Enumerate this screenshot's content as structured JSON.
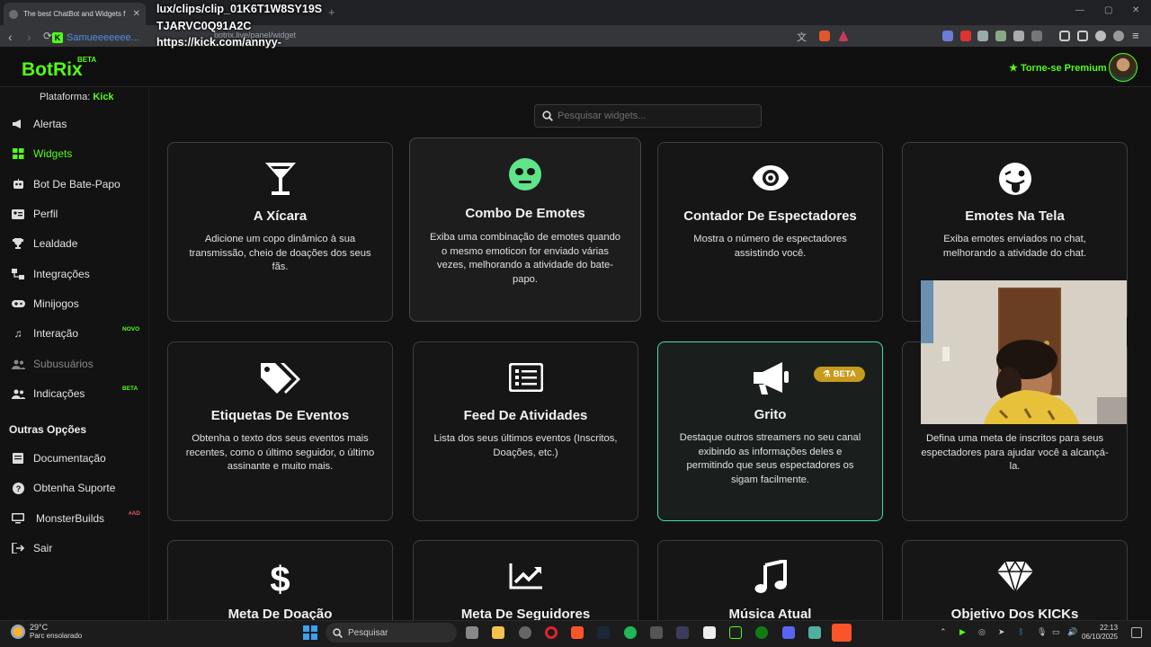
{
  "browser": {
    "tab_title": "The best ChatBot and Widgets f",
    "url": "botrix.live/panel/widget",
    "ghost_channel": "Samueeeeeee..."
  },
  "overlay": {
    "text": "lux/clips/clip_01K6T1W8SY19S\nTJARVC0Q91A2C\nhttps://kick.com/annyy-\nlux/clips/clip_01K6T1W8SY19S\nTJARVC0Q91A2C"
  },
  "header": {
    "logo": "BotRix",
    "logo_badge": "BETA",
    "premium_label": "Torne-se Premium"
  },
  "sidebar": {
    "platform_label": "Plataforma:",
    "platform_value": "Kick",
    "items": [
      {
        "label": "Alertas",
        "icon": "megaphone-icon"
      },
      {
        "label": "Widgets",
        "icon": "grid-icon"
      },
      {
        "label": "Bot De Bate-Papo",
        "icon": "robot-icon"
      },
      {
        "label": "Perfil",
        "icon": "id-card-icon"
      },
      {
        "label": "Lealdade",
        "icon": "trophy-icon"
      },
      {
        "label": "Integrações",
        "icon": "integration-icon"
      },
      {
        "label": "Minijogos",
        "icon": "gamepad-icon"
      },
      {
        "label": "Interação",
        "icon": "music-icon",
        "badge": "NOVO"
      },
      {
        "label": "Subusuários",
        "icon": "users-icon"
      },
      {
        "label": "Indicações",
        "icon": "user-group-icon",
        "badge": "BETA"
      }
    ],
    "other_heading": "Outras Opções",
    "other_items": [
      {
        "label": "Documentação",
        "icon": "book-icon"
      },
      {
        "label": "Obtenha Suporte",
        "icon": "help-icon"
      },
      {
        "label": "MonsterBuilds",
        "icon": "monitor-icon",
        "badge": "#AD"
      },
      {
        "label": "Sair",
        "icon": "logout-icon"
      }
    ]
  },
  "search": {
    "placeholder": "Pesquisar widgets..."
  },
  "widgets": [
    {
      "title": "A Xícara",
      "desc": "Adicione um copo dinâmico à sua transmissão, cheio de doações dos seus fãs.",
      "icon": "cocktail-icon"
    },
    {
      "title": "Combo De Emotes",
      "desc": "Exiba uma combinação de emotes quando o mesmo emoticon for enviado várias vezes, melhorando a atividade do bate-papo.",
      "icon": "emote-face-icon"
    },
    {
      "title": "Contador De Espectadores",
      "desc": "Mostra o número de espectadores assistindo você.",
      "icon": "eye-icon"
    },
    {
      "title": "Emotes Na Tela",
      "desc": "Exiba emotes enviados no chat, melhorando a atividade do chat.",
      "icon": "tongue-face-icon"
    },
    {
      "title": "Etiquetas De Eventos",
      "desc": "Obtenha o texto dos seus eventos mais recentes, como o último seguidor, o último assinante e muito mais.",
      "icon": "tags-icon"
    },
    {
      "title": "Feed De Atividades",
      "desc": "Lista dos seus últimos eventos (Inscritos, Doações, etc.)",
      "icon": "list-icon"
    },
    {
      "title": "Grito",
      "desc": "Destaque outros streamers no seu canal exibindo as informações deles e permitindo que seus espectadores os sigam facilmente.",
      "icon": "bullhorn-icon",
      "badge": "BETA"
    },
    {
      "title": "",
      "desc": "Defina uma meta de inscritos para seus espectadores para ajudar você a alcançá-la.",
      "icon": ""
    },
    {
      "title": "Meta De Doação",
      "desc": "",
      "icon": "dollar-icon"
    },
    {
      "title": "Meta De Seguidores",
      "desc": "",
      "icon": "chart-line-icon"
    },
    {
      "title": "Música Atual",
      "desc": "",
      "icon": "music-note-icon"
    },
    {
      "title": "Objetivo Dos KICKs",
      "desc": "",
      "icon": "diamond-icon"
    }
  ],
  "taskbar": {
    "temperature": "29°C",
    "weather": "Parc ensolarado",
    "search_label": "Pesquisar",
    "time": "22:13",
    "date": "06/10/2025"
  },
  "colors": {
    "accent": "#53fc18",
    "highlight_border": "#3ee0b0",
    "beta_chip": "#c79b1d"
  }
}
